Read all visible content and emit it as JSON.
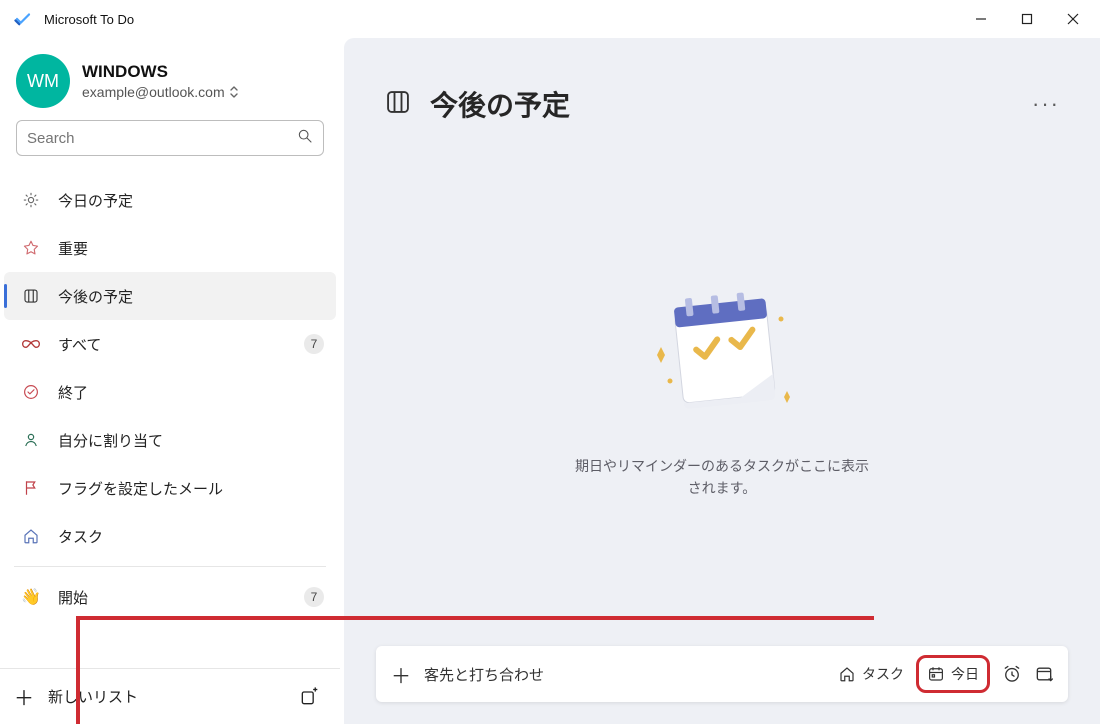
{
  "window": {
    "title": "Microsoft To Do"
  },
  "profile": {
    "avatar_initials": "WM",
    "name": "WINDOWS",
    "email": "example@outlook.com"
  },
  "search": {
    "placeholder": "Search"
  },
  "nav": {
    "items": [
      {
        "icon": "sun",
        "label": "今日の予定"
      },
      {
        "icon": "star",
        "label": "重要"
      },
      {
        "icon": "planned",
        "label": "今後の予定",
        "selected": true
      },
      {
        "icon": "infinity",
        "label": "すべて",
        "badge": "7"
      },
      {
        "icon": "completed",
        "label": "終了"
      },
      {
        "icon": "assigned",
        "label": "自分に割り当て"
      },
      {
        "icon": "flag",
        "label": "フラグを設定したメール"
      },
      {
        "icon": "home",
        "label": "タスク"
      }
    ],
    "start_label": "開始",
    "start_badge": "7",
    "new_list_label": "新しいリスト"
  },
  "main": {
    "title": "今後の予定",
    "empty_text": "期日やリマインダーのあるタスクがここに表示されます。"
  },
  "addbar": {
    "task_text": "客先と打ち合わせ",
    "list_chip": "タスク",
    "today_chip": "今日"
  }
}
